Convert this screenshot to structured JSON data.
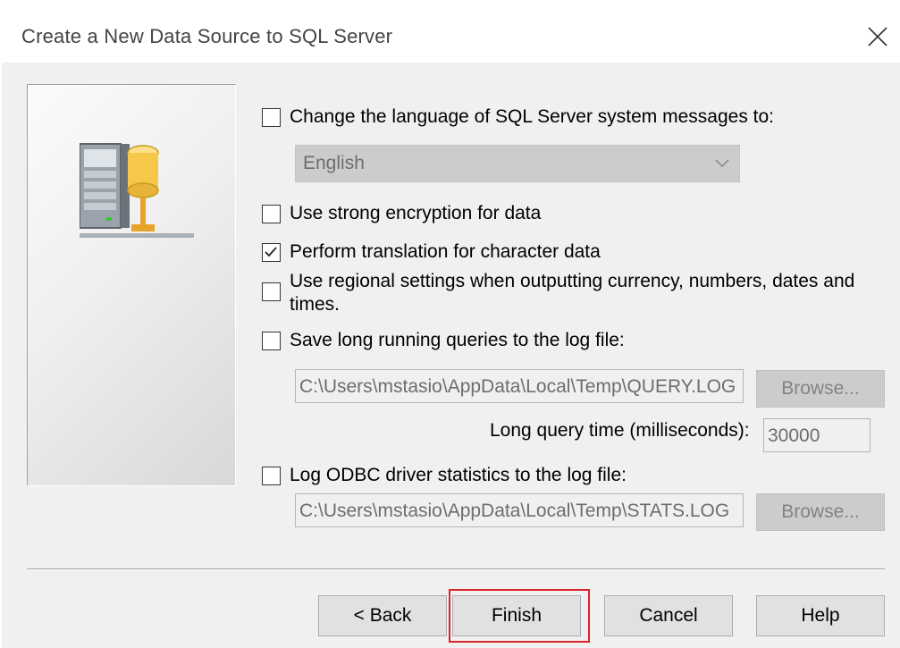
{
  "window": {
    "title": "Create a New Data Source to SQL Server",
    "close_icon": "close-icon"
  },
  "options": {
    "change_language": {
      "label": "Change the language of SQL Server system messages to:",
      "checked": false
    },
    "language_select": {
      "value": "English",
      "enabled": false
    },
    "strong_encryption": {
      "label": "Use strong encryption for data",
      "checked": false
    },
    "translate_char_data": {
      "label": "Perform translation for character data",
      "checked": true
    },
    "regional_settings": {
      "label": "Use regional settings when outputting currency, numbers, dates and times.",
      "checked": false
    },
    "save_long_queries": {
      "label": "Save long running queries to the log file:",
      "checked": false
    },
    "query_log_path": "C:\\Users\\mstasio\\AppData\\Local\\Temp\\QUERY.LOG",
    "long_query_time_label": "Long query time (milliseconds):",
    "long_query_time_value": "30000",
    "log_driver_stats": {
      "label": "Log ODBC driver statistics to the log file:",
      "checked": false
    },
    "stats_log_path": "C:\\Users\\mstasio\\AppData\\Local\\Temp\\STATS.LOG",
    "browse_label": "Browse..."
  },
  "buttons": {
    "back": "< Back",
    "finish": "Finish",
    "cancel": "Cancel",
    "help": "Help"
  },
  "colors": {
    "highlight": "#d9232d"
  }
}
